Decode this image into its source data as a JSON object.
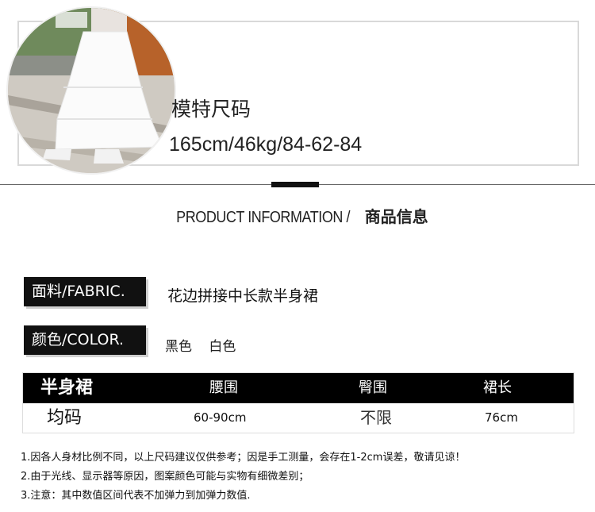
{
  "model": {
    "photo_icon": "model-photo",
    "title": "模特尺码",
    "value": "165cm/46kg/84-62-84"
  },
  "section": {
    "title_en": "PRODUCT INFORMATION /",
    "title_zh": "商品信息"
  },
  "fabric": {
    "label": "面料/FABRIC.",
    "value": "花边拼接中长款半身裙"
  },
  "color": {
    "label": "颜色/COLOR.",
    "values": [
      "黑色",
      "白色"
    ]
  },
  "size_table": {
    "headers": [
      "半身裙",
      "腰围",
      "臀围",
      "裙长"
    ],
    "row": [
      "均码",
      "60-90cm",
      "不限",
      "76cm"
    ]
  },
  "notes": [
    "1.因各人身材比例不同，以上尺码建议仅供参考；因是手工测量，会存在1-2cm误差，敬请见谅！",
    "2.由于光线、显示器等原因，图案颜色可能与实物有细微差别；",
    "3.注意：其中数值区间代表不加弹力到加弹力数值."
  ]
}
